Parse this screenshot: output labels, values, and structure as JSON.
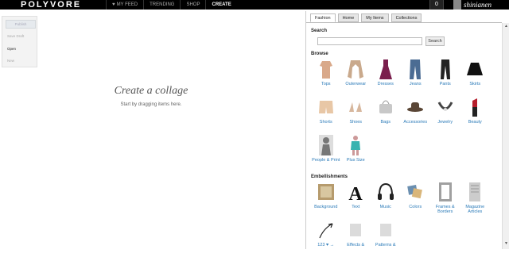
{
  "topbar": {
    "logo": "POLYVORE",
    "nav": [
      {
        "label": "MY FEED",
        "icon": "heart-icon",
        "active": false
      },
      {
        "label": "TRENDING",
        "active": false
      },
      {
        "label": "SHOP",
        "active": false
      },
      {
        "label": "CREATE",
        "active": true
      }
    ],
    "notification_count": "0",
    "username": "shinianen"
  },
  "leftmenu": {
    "publish": "Publish",
    "save_draft": "Save Draft",
    "open": "Open",
    "new": "New"
  },
  "canvas": {
    "title": "Create a collage",
    "subtitle": "Start by dragging items here."
  },
  "panel": {
    "tabs": [
      "Fashion",
      "Home",
      "My Items",
      "Collections"
    ],
    "search_label": "Search",
    "search_value": "",
    "search_button": "Search",
    "browse_label": "Browse",
    "browse": [
      {
        "label": "Tops",
        "icon": "top-icon",
        "color": "#d9a98a"
      },
      {
        "label": "Outerwear",
        "icon": "jacket-icon",
        "color": "#c9a98c"
      },
      {
        "label": "Dresses",
        "icon": "dress-icon",
        "color": "#7a1f4d"
      },
      {
        "label": "Jeans",
        "icon": "jeans-icon",
        "color": "#4b6c93"
      },
      {
        "label": "Pants",
        "icon": "pants-icon",
        "color": "#222222"
      },
      {
        "label": "Skirts",
        "icon": "skirt-icon",
        "color": "#111111"
      },
      {
        "label": "Shorts",
        "icon": "shorts-icon",
        "color": "#e8c7a6"
      },
      {
        "label": "Shoes",
        "icon": "shoes-icon",
        "color": "#d7b79d"
      },
      {
        "label": "Bags",
        "icon": "bag-icon",
        "color": "#c8c8c8"
      },
      {
        "label": "Accessories",
        "icon": "hat-icon",
        "color": "#5a4636"
      },
      {
        "label": "Jewelry",
        "icon": "necklace-icon",
        "color": "#444444"
      },
      {
        "label": "Beauty",
        "icon": "lipstick-icon",
        "color": "#b51e2c"
      },
      {
        "label": "People & Print",
        "icon": "person-icon",
        "color": "#777777"
      },
      {
        "label": "Plus Size",
        "icon": "plus-size-icon",
        "color": "#39b3b0"
      }
    ],
    "embellishments_label": "Embellishments",
    "embellishments": [
      {
        "label": "Background",
        "icon": "background-icon",
        "color": "#b69b6d"
      },
      {
        "label": "Text",
        "icon": "text-icon",
        "color": "#111111"
      },
      {
        "label": "Music",
        "icon": "headphones-icon",
        "color": "#222222"
      },
      {
        "label": "Colors",
        "icon": "color-swatches-icon",
        "color": "#6b8fb0"
      },
      {
        "label": "Frames & Borders",
        "icon": "frame-icon",
        "color": "#a0a0a0"
      },
      {
        "label": "Magazine Articles",
        "icon": "magazine-icon",
        "color": "#cccccc"
      },
      {
        "label": "123 ♥ →",
        "icon": "arrow-icon",
        "color": "#222222"
      },
      {
        "label": "Effects &",
        "icon": "effects-icon",
        "color": "#888888"
      },
      {
        "label": "Patterns &",
        "icon": "patterns-icon",
        "color": "#888888"
      }
    ]
  }
}
